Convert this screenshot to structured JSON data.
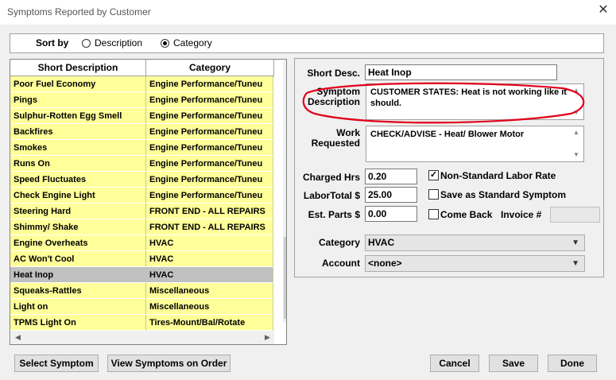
{
  "window": {
    "title": "Symptoms Reported by Customer",
    "close_glyph": "✕"
  },
  "sort": {
    "label": "Sort by",
    "options": [
      {
        "label": "Description",
        "selected": false
      },
      {
        "label": "Category",
        "selected": true
      }
    ]
  },
  "list": {
    "columns": [
      "Short Description",
      "Category"
    ],
    "rows": [
      {
        "desc": "Poor Fuel Economy",
        "cat": "Engine Performance/Tuneu"
      },
      {
        "desc": "Pings",
        "cat": "Engine Performance/Tuneu"
      },
      {
        "desc": "Sulphur-Rotten Egg Smell",
        "cat": "Engine Performance/Tuneu"
      },
      {
        "desc": "Backfires",
        "cat": "Engine Performance/Tuneu"
      },
      {
        "desc": "Smokes",
        "cat": "Engine Performance/Tuneu"
      },
      {
        "desc": "Runs On",
        "cat": "Engine Performance/Tuneu"
      },
      {
        "desc": "Speed Fluctuates",
        "cat": "Engine Performance/Tuneu"
      },
      {
        "desc": "Check Engine Light",
        "cat": "Engine Performance/Tuneu"
      },
      {
        "desc": "Steering Hard",
        "cat": "FRONT END - ALL REPAIRS"
      },
      {
        "desc": "Shimmy/ Shake",
        "cat": "FRONT END - ALL REPAIRS"
      },
      {
        "desc": "Engine Overheats",
        "cat": "HVAC"
      },
      {
        "desc": "AC Won't Cool",
        "cat": "HVAC"
      },
      {
        "desc": "Heat Inop",
        "cat": "HVAC",
        "selected": true
      },
      {
        "desc": "Squeaks-Rattles",
        "cat": "Miscellaneous"
      },
      {
        "desc": "Light on",
        "cat": "Miscellaneous"
      },
      {
        "desc": "TPMS Light On",
        "cat": "Tires-Mount/Bal/Rotate"
      }
    ]
  },
  "detail": {
    "short_desc_label": "Short Desc.",
    "short_desc_value": "Heat Inop",
    "symptom_label_1": "Symptom",
    "symptom_label_2": "Description",
    "symptom_value": "CUSTOMER STATES: Heat is not working like it should.",
    "work_label_1": "Work",
    "work_label_2": "Requested",
    "work_value": "CHECK/ADVISE - Heat/ Blower Motor",
    "charged_hrs_label": "Charged Hrs",
    "charged_hrs_value": "0.20",
    "labor_total_label": "LaborTotal $",
    "labor_total_value": "25.00",
    "est_parts_label": "Est. Parts $",
    "est_parts_value": "0.00",
    "nonstandard_label": "Non-Standard Labor Rate",
    "nonstandard_checked": true,
    "save_standard_label": "Save as Standard Symptom",
    "come_back_label": "Come Back",
    "invoice_label": "Invoice #",
    "category_label": "Category",
    "category_value": "HVAC",
    "account_label": "Account",
    "account_value": "<none>"
  },
  "buttons": {
    "select_symptom": "Select Symptom",
    "view_symptoms": "View Symptoms on Order",
    "cancel": "Cancel",
    "save": "Save",
    "done": "Done"
  },
  "colors": {
    "row_bg": "#ffff99",
    "selected_row_bg": "#c0c0c0",
    "annotation_red": "#e0001a"
  }
}
